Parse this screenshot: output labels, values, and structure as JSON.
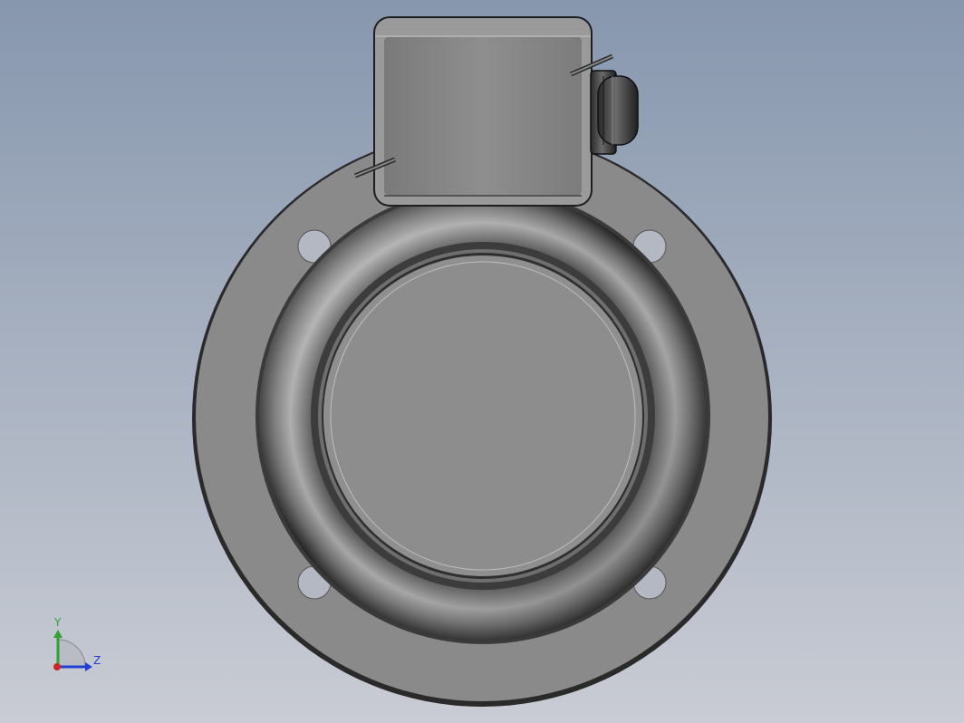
{
  "viewport": {
    "background_top": "#8797ae",
    "background_bottom": "#c9ccd4"
  },
  "model": {
    "part_color": "#8c8c8c",
    "edge_color": "#262626",
    "hole_color": "#b0b5c0"
  },
  "triad": {
    "y_label": "Y",
    "z_label": "Z",
    "y_color": "#2fa32f",
    "z_color": "#1f3fd6",
    "x_color": "#d0261f"
  }
}
